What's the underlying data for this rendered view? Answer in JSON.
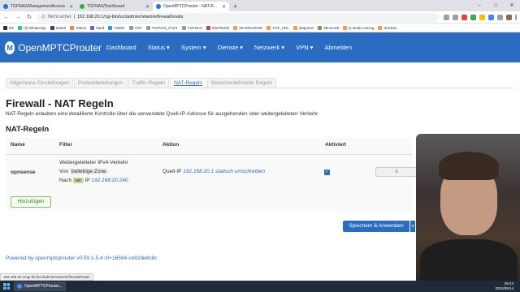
{
  "browser": {
    "tabs": [
      {
        "title": "TGFNAS/ManagementAccess",
        "color": "#1a73e8",
        "active": false
      },
      {
        "title": "TGFNAS/Dashboard",
        "color": "#34a853",
        "active": false
      },
      {
        "title": "OpenMPTCProuter - NAT-Regeln - LuCI",
        "color": "#1a73e8",
        "active": true
      }
    ],
    "new_tab": "+",
    "window_controls": {
      "minimize": "–",
      "maximize": "□",
      "close": "✕"
    },
    "address_warning": "Nicht sicher",
    "url": "192.168.20.1/cgi-bin/luci/admin/network/firewall/snats",
    "bookmarks": [
      "DE",
      "(3) WhatsApp",
      "tumblr",
      "videos",
      "band",
      "Twitter",
      "TGF",
      "TGFNAS_FAST",
      "TGFNAS",
      "MissTeufel",
      "3D DRUCKER",
      "TGF_URL",
      "diagrams",
      "Minecraft",
      "yt studio umzug",
      "drucken"
    ]
  },
  "app": {
    "brand": "OpenMPTCProuter",
    "logo_letter": "M",
    "nav": [
      "Dashboard",
      "Status ▾",
      "System ▾",
      "Dienste ▾",
      "Netzwerk ▾",
      "VPN ▾",
      "Abmelden"
    ]
  },
  "subtabs": [
    {
      "label": "Allgemeine Einstellungen",
      "active": false
    },
    {
      "label": "Portweiterleitungen",
      "active": false
    },
    {
      "label": "Traffic-Regeln",
      "active": false
    },
    {
      "label": "NAT-Regeln",
      "active": true
    },
    {
      "label": "Benutzerdefinierte Regeln",
      "active": false
    }
  ],
  "page": {
    "title": "Firewall - NAT Regeln",
    "description": "NAT-Regeln erlauben eine detaillierte Kontrolle über die verwendete Quell-IP-Adresse für ausgehenden oder weitergeleiteten Verkehr.",
    "section_title": "NAT-Regeln"
  },
  "table": {
    "headers": {
      "name": "Name",
      "filter": "Filter",
      "action": "Aktion",
      "enabled": "Aktiviert"
    },
    "rows": [
      {
        "name": "opnsense",
        "filter_line1": "Weitergeleiteter IPv4-Verkehr",
        "filter_von_label": "Von",
        "filter_von_value": "beliebige Zone",
        "filter_nach_label": "Nach",
        "filter_nach_value": "lan",
        "filter_ip_label": "IP",
        "filter_ip_value": "192.168.20.240",
        "action_prefix": "Quell-IP",
        "action_value": "192.168.20.1 statisch umschreiben",
        "enabled": true,
        "edit_icon": "≡"
      }
    ]
  },
  "buttons": {
    "add": "Hinzufügen",
    "save": "Speichern & Anwenden",
    "save_caret": "▾"
  },
  "footer": "Powered by openmptcprouter v0.59.1-5.4 r0+16594-ce92de8c8c",
  "status_url": "192.168.20.1/cgi-bin/luci/admin/network/firewall/snats",
  "taskbar": {
    "item": "OpenMPTCProuter...",
    "time": "09:43",
    "date": "2022/09/14"
  }
}
